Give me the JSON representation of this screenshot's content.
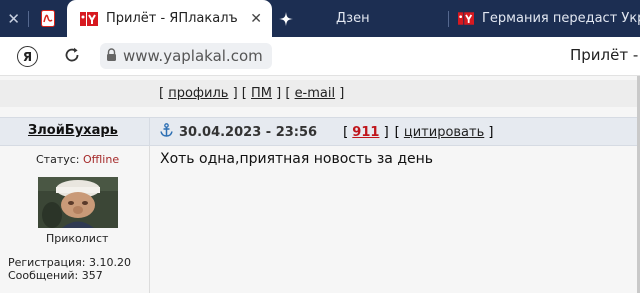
{
  "browser": {
    "tabs": [
      {
        "label": "",
        "icon": "pdf-icon"
      },
      {
        "label": "Прилёт - ЯПлакалъ",
        "icon": "yaplakal-favicon",
        "active": true
      },
      {
        "label": "",
        "icon": "sparkle-icon"
      },
      {
        "label": "Дзен",
        "icon": ""
      },
      {
        "label": "Германия передаст Укр",
        "icon": "yaplakal-favicon"
      }
    ],
    "address": "www.yaplakal.com",
    "page_title": "Прилёт - Я",
    "colors": {
      "tabstrip": "#1c2e52",
      "pdf_red": "#d9261c",
      "yaplakal_red": "#d71920"
    }
  },
  "forum": {
    "links": {
      "profile": "профиль",
      "pm": "ПМ",
      "email": "e-mail"
    },
    "post": {
      "author": "ЗлойБухарь",
      "datetime": "30.04.2023 - 23:56",
      "post_number": "911",
      "quote_label": "цитировать",
      "status_label": "Статус:",
      "status_value": "Offline",
      "rank": "Приколист",
      "registration": "Регистрация: 3.10.20",
      "messages": "Сообщений: 357",
      "text": "Хоть одна,приятная новость за день"
    }
  }
}
